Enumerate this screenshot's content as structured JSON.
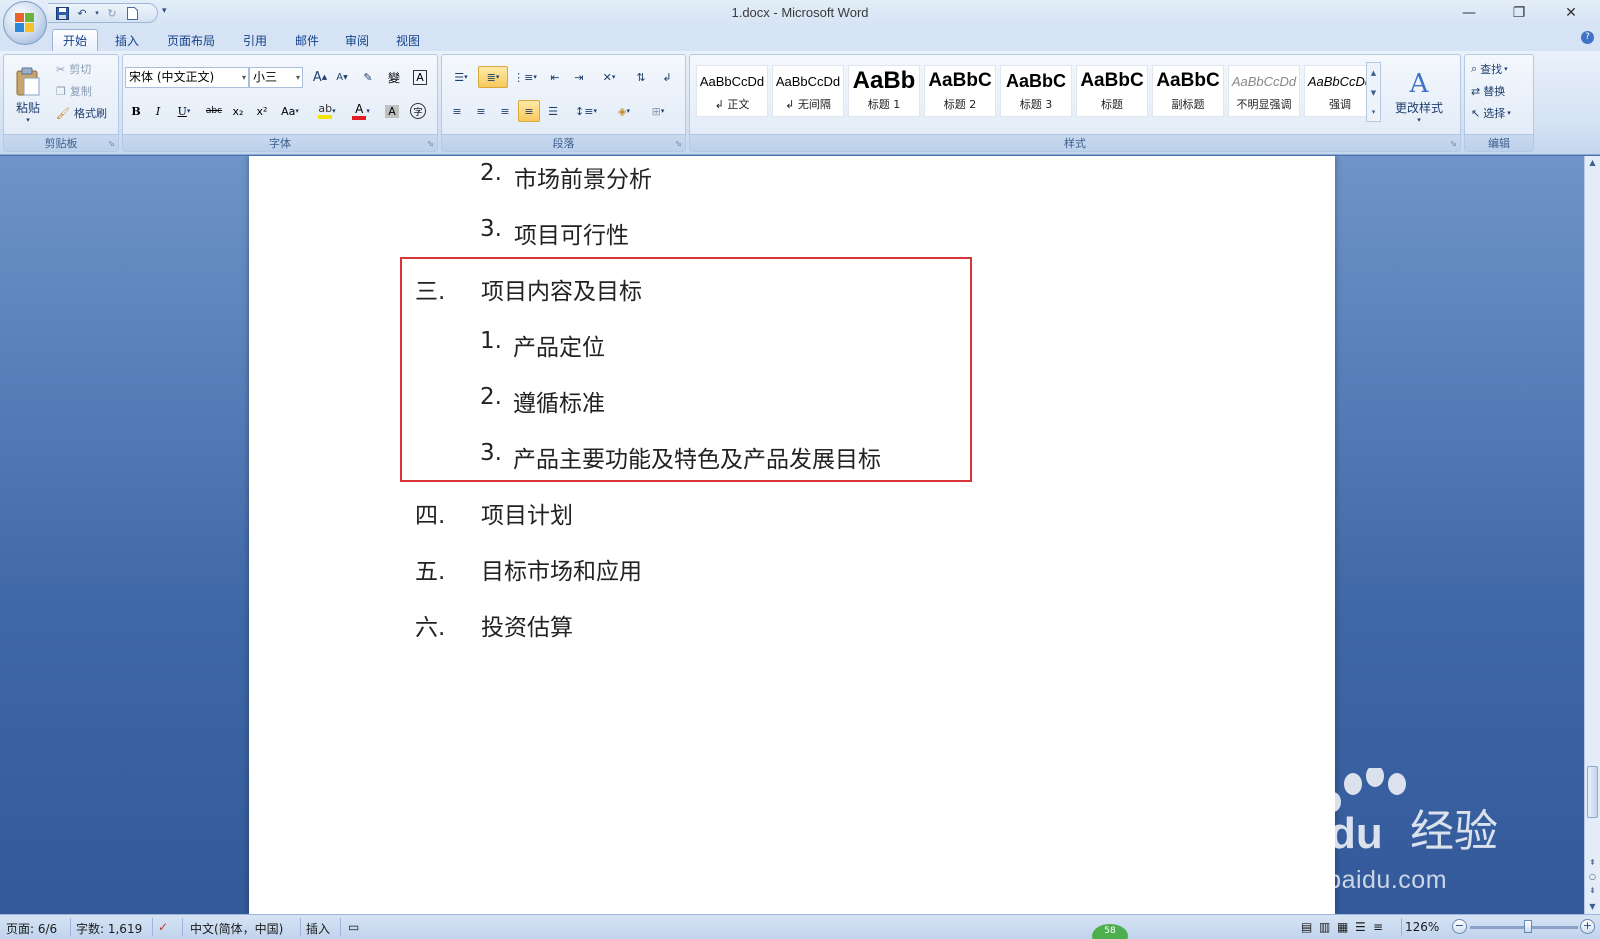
{
  "window": {
    "title": "1.docx - Microsoft Word",
    "minimize_glyph": "—",
    "restore_glyph": "❐",
    "close_glyph": "✕"
  },
  "qat": {
    "save_icon": "save-icon",
    "undo_icon": "undo-icon",
    "redo_icon": "redo-icon",
    "new_icon": "new-document-icon"
  },
  "tabs": [
    {
      "label": "开始",
      "active": true
    },
    {
      "label": "插入"
    },
    {
      "label": "页面布局"
    },
    {
      "label": "引用"
    },
    {
      "label": "邮件"
    },
    {
      "label": "审阅"
    },
    {
      "label": "视图"
    }
  ],
  "ribbon": {
    "clipboard": {
      "label": "剪贴板",
      "paste": "粘贴",
      "cut": "剪切",
      "copy": "复制",
      "format_painter": "格式刷"
    },
    "font": {
      "label": "字体",
      "font_name": "宋体 (中文正文)",
      "font_size": "小三",
      "bold": "B",
      "italic": "I",
      "underline": "U",
      "strikethrough": "abc",
      "subscript": "x₂",
      "superscript": "x²",
      "change_case": "Aa",
      "grow": "A",
      "shrink": "A",
      "phonetic": "變",
      "char_border": "A",
      "font_color": "A",
      "char_shading": "A",
      "enclose": "字",
      "font_color_hex": "#e02020",
      "highlight_hex": "#f5e400"
    },
    "paragraph": {
      "label": "段落"
    },
    "styles": {
      "label": "样式",
      "items": [
        {
          "sample": "AaBbCcDd",
          "name": "↲ 正文"
        },
        {
          "sample": "AaBbCcDd",
          "name": "↲ 无间隔"
        },
        {
          "sample": "AaBb",
          "name": "标题 1"
        },
        {
          "sample": "AaBbC",
          "name": "标题 2"
        },
        {
          "sample": "AaBbC",
          "name": "标题 3"
        },
        {
          "sample": "AaBbC",
          "name": "标题"
        },
        {
          "sample": "AaBbC",
          "name": "副标题"
        },
        {
          "sample": "AaBbCcDd",
          "name": "不明显强调"
        },
        {
          "sample": "AaBbCcDd",
          "name": "强调"
        }
      ],
      "change_styles": "更改样式"
    },
    "editing": {
      "label": "编辑",
      "find": "查找",
      "replace": "替换",
      "select": "选择"
    }
  },
  "document": {
    "lines": [
      {
        "num": "2.",
        "text": "市场前景分析"
      },
      {
        "num": "3.",
        "text": "项目可行性"
      },
      {
        "num": "三.",
        "text": "项目内容及目标"
      },
      {
        "num": "1.",
        "text": "产品定位"
      },
      {
        "num": "2.",
        "text": "遵循标准"
      },
      {
        "num": "3.",
        "text": "产品主要功能及特色及产品发展目标"
      },
      {
        "num": "四.",
        "text": "项目计划"
      },
      {
        "num": "五.",
        "text": "目标市场和应用"
      },
      {
        "num": "六.",
        "text": "投资估算"
      }
    ],
    "highlight_color": "#d8353a"
  },
  "watermark": {
    "logo_text": "Bai du 经验",
    "url": "jingyan.baidu.com"
  },
  "statusbar": {
    "page": "页面: 6/6",
    "word_count": "字数: 1,619",
    "language": "中文(简体，中国)",
    "mode": "插入",
    "zoom": "126%",
    "badge": "58"
  }
}
